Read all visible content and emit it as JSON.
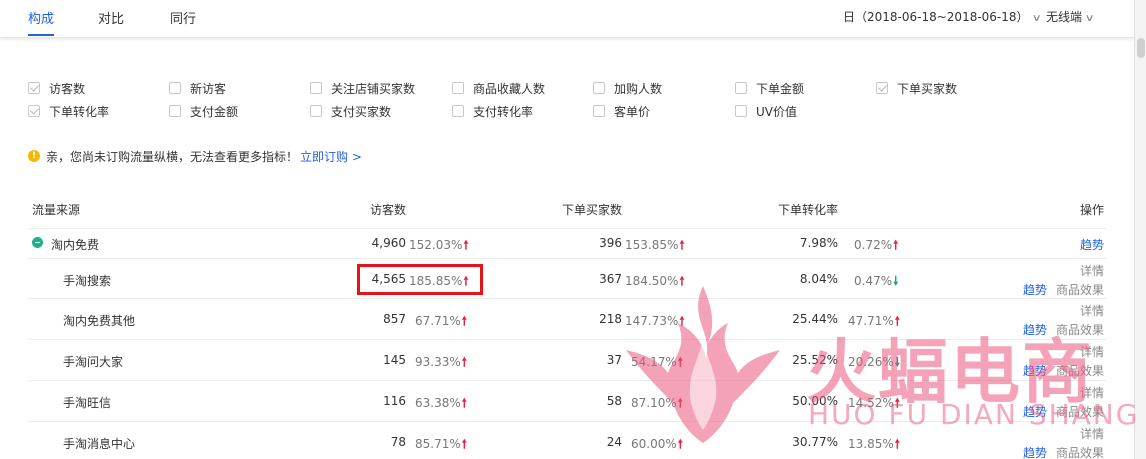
{
  "tabs": [
    {
      "label": "构成",
      "active": true
    },
    {
      "label": "对比",
      "active": false
    },
    {
      "label": "同行",
      "active": false
    }
  ],
  "date_range": "日（2018-06-18~2018-06-18）",
  "terminal": "无线端",
  "metrics": [
    {
      "label": "访客数",
      "checked": true
    },
    {
      "label": "新访客",
      "checked": false
    },
    {
      "label": "关注店铺买家数",
      "checked": false
    },
    {
      "label": "商品收藏人数",
      "checked": false
    },
    {
      "label": "加购人数",
      "checked": false
    },
    {
      "label": "下单金额",
      "checked": false
    },
    {
      "label": "下单买家数",
      "checked": true
    },
    {
      "label": "下单转化率",
      "checked": true
    },
    {
      "label": "支付金额",
      "checked": false
    },
    {
      "label": "支付买家数",
      "checked": false
    },
    {
      "label": "支付转化率",
      "checked": false
    },
    {
      "label": "客单价",
      "checked": false
    },
    {
      "label": "UV价值",
      "checked": false
    }
  ],
  "notice": {
    "text": "亲，您尚未订购流量纵横，无法查看更多指标！",
    "link": "立即订购 >"
  },
  "table": {
    "headers": {
      "source": "流量来源",
      "visitors": "访客数",
      "buyers": "下单买家数",
      "rate": "下单转化率",
      "action": "操作"
    },
    "group": {
      "name": "淘内免费",
      "visitors": "4,960",
      "visitors_pct": "152.03%",
      "buyers": "396",
      "buyers_pct": "153.85%",
      "rate": "7.98%",
      "rate_pct": "0.72%",
      "action": "趋势"
    },
    "rows": [
      {
        "name": "手淘搜索",
        "visitors": "4,565",
        "visitors_pct": "185.85%",
        "buyers": "367",
        "buyers_pct": "184.50%",
        "rate": "8.04%",
        "rate_pct": "0.47%",
        "rate_dir": "down"
      },
      {
        "name": "淘内免费其他",
        "visitors": "857",
        "visitors_pct": "67.71%",
        "buyers": "218",
        "buyers_pct": "147.73%",
        "rate": "25.44%",
        "rate_pct": "47.71%",
        "rate_dir": "up"
      },
      {
        "name": "手淘问大家",
        "visitors": "145",
        "visitors_pct": "93.33%",
        "buyers": "37",
        "buyers_pct": "54.17%",
        "rate": "25.52%",
        "rate_pct": "20.26%",
        "rate_dir": "down"
      },
      {
        "name": "手淘旺信",
        "visitors": "116",
        "visitors_pct": "63.38%",
        "buyers": "58",
        "buyers_pct": "87.10%",
        "rate": "50.00%",
        "rate_pct": "14.52%",
        "rate_dir": "up"
      },
      {
        "name": "手淘消息中心",
        "visitors": "78",
        "visitors_pct": "85.71%",
        "buyers": "24",
        "buyers_pct": "60.00%",
        "rate": "30.77%",
        "rate_pct": "13.85%",
        "rate_dir": "up"
      }
    ],
    "row_actions": {
      "detail": "详情",
      "trend": "趋势",
      "product": "商品效果"
    }
  },
  "watermark": {
    "cn": "火蝠电商",
    "en": "HUO FU DIAN SHANG"
  },
  "colors": {
    "accent": "#2062e6",
    "up": "#e8253f",
    "down": "#16a085",
    "highlight": "#e3141c",
    "watermark": "#e9567b"
  }
}
